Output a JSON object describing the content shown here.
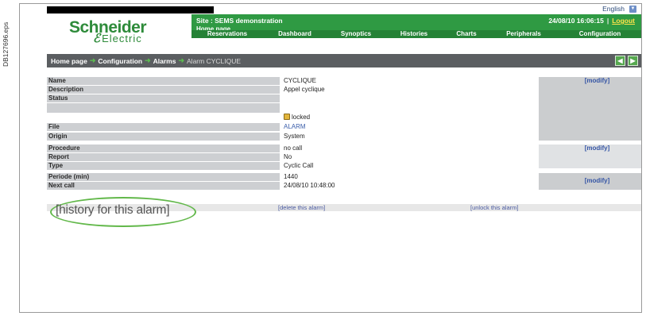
{
  "side_code": "DB127696.eps",
  "header": {
    "language": "English",
    "logo_top": "Schneider",
    "logo_bottom": "Electric",
    "site_title": "Site : SEMS demonstration",
    "home_link": "Home page",
    "datetime": "24/08/10 16:06:15",
    "separator": "|",
    "logout": "Logout",
    "nav": [
      "Reservations",
      "Dashboard",
      "Synoptics",
      "Histories",
      "Charts",
      "Peripherals",
      "Configuration"
    ]
  },
  "breadcrumb": {
    "items": [
      "Home page",
      "Configuration",
      "Alarms"
    ],
    "current": "Alarm CYCLIQUE",
    "buttons": [
      "◀",
      "▶"
    ]
  },
  "detail": {
    "rows": [
      {
        "label": "Name",
        "value": "CYCLIQUE"
      },
      {
        "label": "Description",
        "value": "Appel cyclique"
      },
      {
        "label": "Status",
        "value": ""
      },
      {
        "label": "",
        "value": "locked"
      },
      {
        "label": "File",
        "value": "ALARM"
      },
      {
        "label": "Origin",
        "value": "System"
      },
      {
        "label": "Procedure",
        "value": "no call"
      },
      {
        "label": "Report",
        "value": "No"
      },
      {
        "label": "Type",
        "value": "Cyclic Call"
      },
      {
        "label": "Periode (min)",
        "value": "1440"
      },
      {
        "label": "Next call",
        "value": "24/08/10 10:48:00"
      }
    ],
    "modify_label": "[modify]"
  },
  "actions": {
    "history": "[history for this alarm]",
    "delete": "[delete this alarm]",
    "unlock": "[unlock this alarm]"
  },
  "colors": {
    "brand_green": "#2f9a43",
    "nav_green": "#258236",
    "breadcrumb_grey": "#5b5e61",
    "label_grey": "#cdcfd2",
    "highlight_green": "#62b84a"
  }
}
